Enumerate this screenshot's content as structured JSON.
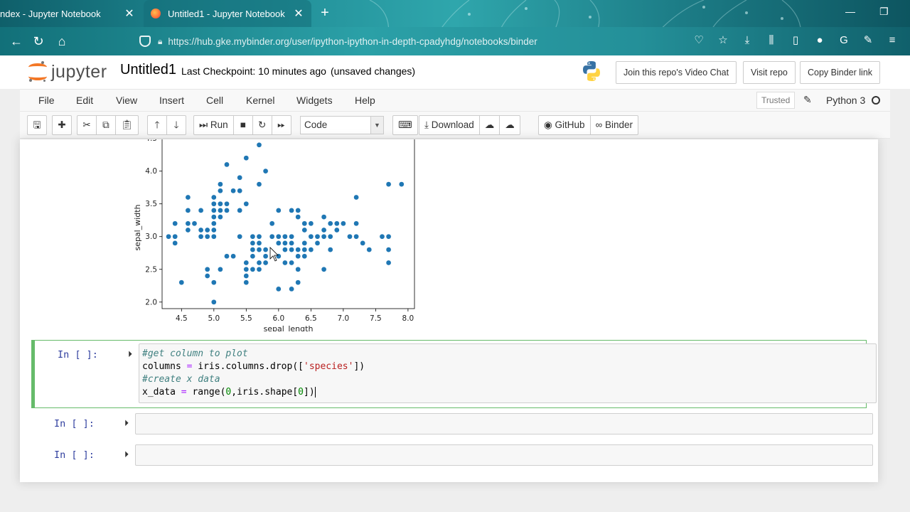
{
  "browser": {
    "tabs": [
      {
        "title": "ndex - Jupyter Notebook",
        "close": "✕"
      },
      {
        "title": "Untitled1 - Jupyter Notebook",
        "close": "✕"
      }
    ],
    "new_tab": "+",
    "url": "https://hub.gke.mybinder.org/user/ipython-ipython-in-depth-cpadyhdg/notebooks/binder",
    "url_domain": "mybinder.org"
  },
  "header": {
    "logo_text": "jupyter",
    "notebook_title": "Untitled1",
    "checkpoint": "Last Checkpoint: 10 minutes ago",
    "status": "(unsaved changes)",
    "buttons": [
      "Join this repo's Video Chat",
      "Visit repo",
      "Copy Binder link"
    ]
  },
  "menubar": {
    "items": [
      "File",
      "Edit",
      "View",
      "Insert",
      "Cell",
      "Kernel",
      "Widgets",
      "Help"
    ],
    "trusted": "Trusted",
    "kernel": "Python 3"
  },
  "toolbar": {
    "run_label": "Run",
    "cell_type": "Code",
    "download_label": "Download",
    "github_label": "GitHub",
    "binder_label": "Binder"
  },
  "chart_data": {
    "type": "scatter",
    "xlabel": "sepal_length",
    "ylabel": "sepal_width",
    "xticks": [
      "4.5",
      "5.0",
      "5.5",
      "6.0",
      "6.5",
      "7.0",
      "7.5",
      "8.0"
    ],
    "yticks": [
      "2.0",
      "2.5",
      "3.0",
      "3.5",
      "4.0",
      "4.5"
    ],
    "xlim": [
      4.2,
      8.1
    ],
    "ylim": [
      1.9,
      4.55
    ],
    "color": "#1f77b4",
    "points": [
      [
        5.1,
        3.5
      ],
      [
        4.9,
        3.0
      ],
      [
        4.7,
        3.2
      ],
      [
        4.6,
        3.1
      ],
      [
        5.0,
        3.6
      ],
      [
        5.4,
        3.9
      ],
      [
        4.6,
        3.4
      ],
      [
        5.0,
        3.4
      ],
      [
        4.4,
        2.9
      ],
      [
        4.9,
        3.1
      ],
      [
        5.4,
        3.7
      ],
      [
        4.8,
        3.4
      ],
      [
        4.8,
        3.0
      ],
      [
        4.3,
        3.0
      ],
      [
        5.8,
        4.0
      ],
      [
        5.7,
        4.4
      ],
      [
        5.4,
        3.9
      ],
      [
        5.1,
        3.5
      ],
      [
        5.7,
        3.8
      ],
      [
        5.1,
        3.8
      ],
      [
        5.4,
        3.4
      ],
      [
        5.1,
        3.7
      ],
      [
        4.6,
        3.6
      ],
      [
        5.1,
        3.3
      ],
      [
        4.8,
        3.4
      ],
      [
        5.0,
        3.0
      ],
      [
        5.0,
        3.4
      ],
      [
        5.2,
        3.5
      ],
      [
        5.2,
        3.4
      ],
      [
        4.7,
        3.2
      ],
      [
        4.8,
        3.1
      ],
      [
        5.4,
        3.4
      ],
      [
        5.2,
        4.1
      ],
      [
        5.5,
        4.2
      ],
      [
        4.9,
        3.1
      ],
      [
        5.0,
        3.2
      ],
      [
        5.5,
        3.5
      ],
      [
        4.4,
        3.0
      ],
      [
        5.1,
        3.4
      ],
      [
        5.0,
        3.5
      ],
      [
        4.5,
        2.3
      ],
      [
        4.4,
        3.2
      ],
      [
        5.0,
        3.5
      ],
      [
        5.1,
        3.8
      ],
      [
        4.8,
        3.0
      ],
      [
        5.1,
        3.8
      ],
      [
        4.6,
        3.2
      ],
      [
        5.3,
        3.7
      ],
      [
        5.0,
        3.3
      ],
      [
        7.0,
        3.2
      ],
      [
        6.4,
        3.2
      ],
      [
        6.9,
        3.1
      ],
      [
        5.5,
        2.3
      ],
      [
        6.5,
        2.8
      ],
      [
        5.7,
        2.8
      ],
      [
        6.3,
        3.3
      ],
      [
        4.9,
        2.4
      ],
      [
        6.6,
        2.9
      ],
      [
        5.2,
        2.7
      ],
      [
        5.0,
        2.0
      ],
      [
        5.9,
        3.0
      ],
      [
        6.0,
        2.2
      ],
      [
        6.1,
        2.9
      ],
      [
        5.6,
        2.9
      ],
      [
        6.7,
        3.1
      ],
      [
        5.6,
        3.0
      ],
      [
        5.8,
        2.7
      ],
      [
        6.2,
        2.2
      ],
      [
        5.6,
        2.5
      ],
      [
        5.9,
        3.2
      ],
      [
        6.1,
        2.8
      ],
      [
        6.3,
        2.5
      ],
      [
        6.4,
        2.9
      ],
      [
        6.6,
        3.0
      ],
      [
        6.8,
        2.8
      ],
      [
        6.7,
        3.0
      ],
      [
        6.0,
        2.9
      ],
      [
        5.7,
        2.6
      ],
      [
        5.5,
        2.4
      ],
      [
        5.5,
        2.4
      ],
      [
        5.8,
        2.7
      ],
      [
        6.0,
        2.7
      ],
      [
        5.4,
        3.0
      ],
      [
        6.0,
        3.4
      ],
      [
        6.7,
        3.1
      ],
      [
        6.3,
        2.3
      ],
      [
        5.6,
        3.0
      ],
      [
        5.5,
        2.5
      ],
      [
        5.5,
        2.6
      ],
      [
        6.1,
        3.0
      ],
      [
        5.8,
        2.6
      ],
      [
        5.0,
        2.3
      ],
      [
        5.6,
        2.7
      ],
      [
        5.7,
        3.0
      ],
      [
        5.7,
        2.9
      ],
      [
        6.2,
        2.9
      ],
      [
        5.1,
        2.5
      ],
      [
        5.7,
        2.8
      ],
      [
        6.3,
        3.3
      ],
      [
        7.1,
        3.0
      ],
      [
        6.5,
        3.0
      ],
      [
        7.6,
        3.0
      ],
      [
        4.9,
        2.5
      ],
      [
        7.3,
        2.9
      ],
      [
        6.7,
        2.5
      ],
      [
        7.2,
        3.6
      ],
      [
        6.5,
        3.2
      ],
      [
        6.4,
        2.7
      ],
      [
        6.8,
        3.0
      ],
      [
        5.7,
        2.5
      ],
      [
        5.8,
        2.8
      ],
      [
        6.4,
        3.2
      ],
      [
        6.5,
        3.0
      ],
      [
        7.7,
        3.8
      ],
      [
        7.7,
        2.6
      ],
      [
        6.0,
        2.2
      ],
      [
        6.9,
        3.2
      ],
      [
        5.6,
        2.8
      ],
      [
        7.7,
        2.8
      ],
      [
        6.3,
        2.7
      ],
      [
        6.7,
        3.3
      ],
      [
        7.2,
        3.2
      ],
      [
        6.2,
        2.8
      ],
      [
        6.1,
        3.0
      ],
      [
        6.4,
        2.8
      ],
      [
        7.2,
        3.0
      ],
      [
        7.4,
        2.8
      ],
      [
        7.9,
        3.8
      ],
      [
        6.4,
        2.8
      ],
      [
        6.3,
        2.8
      ],
      [
        6.1,
        2.6
      ],
      [
        7.7,
        3.0
      ],
      [
        6.3,
        3.4
      ],
      [
        6.4,
        3.1
      ],
      [
        6.0,
        3.0
      ],
      [
        6.9,
        3.1
      ],
      [
        6.7,
        3.1
      ],
      [
        5.8,
        2.7
      ],
      [
        6.8,
        3.2
      ],
      [
        6.7,
        3.3
      ],
      [
        6.3,
        2.5
      ],
      [
        6.5,
        3.0
      ],
      [
        6.2,
        3.4
      ],
      [
        5.9,
        3.0
      ],
      [
        6.1,
        3.0
      ],
      [
        5.3,
        2.7
      ],
      [
        6.2,
        2.6
      ],
      [
        6.6,
        3.0
      ],
      [
        5.2,
        3.4
      ],
      [
        5.0,
        3.1
      ],
      [
        5.8,
        2.6
      ],
      [
        6.8,
        2.8
      ],
      [
        7.1,
        3.0
      ],
      [
        6.2,
        3.0
      ]
    ]
  },
  "cells": [
    {
      "prompt": "In [ ]:",
      "lines": [
        "#get column to plot",
        "columns = iris.columns.drop(['species'])",
        "#create x data",
        "x_data = range(0,iris.shape[0])"
      ]
    },
    {
      "prompt": "In [ ]:"
    },
    {
      "prompt": "In [ ]:"
    }
  ]
}
